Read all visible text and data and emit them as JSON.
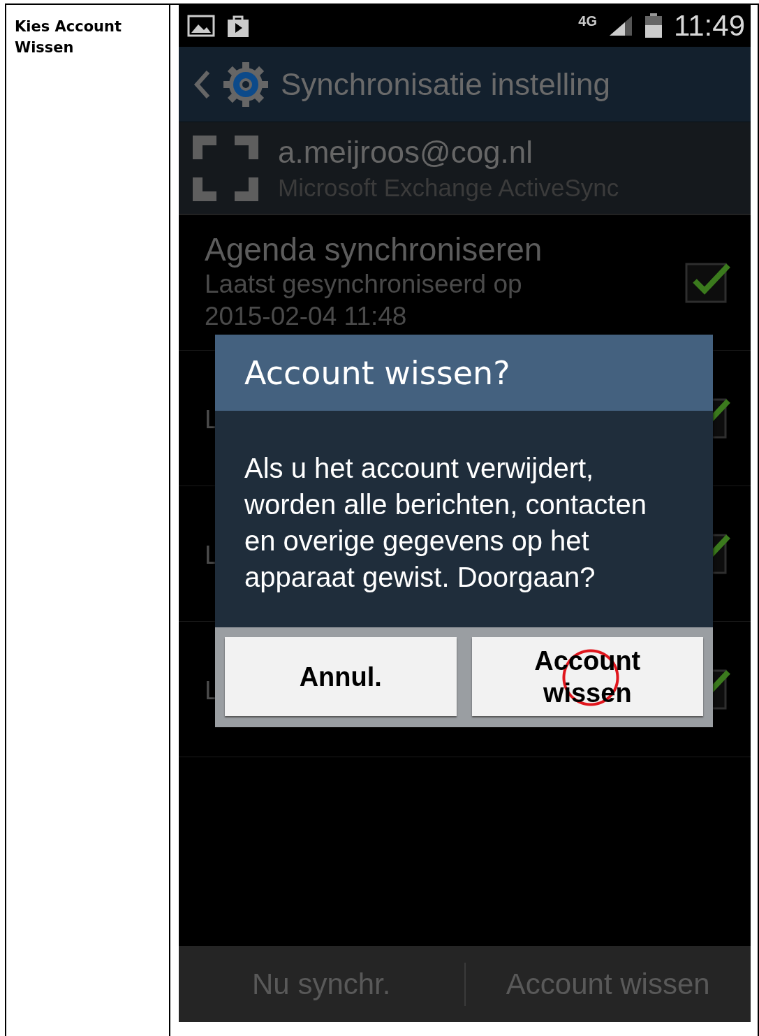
{
  "document": {
    "step_label": "Kies Account Wissen"
  },
  "phone": {
    "status_bar": {
      "network": "4G",
      "time": "11:49"
    },
    "action_bar": {
      "title": "Synchronisatie instelling"
    },
    "account": {
      "email": "a.meijroos@cog.nl",
      "type": "Microsoft Exchange ActiveSync"
    },
    "sync_items": [
      {
        "title": "Agenda synchroniseren",
        "subtitle": "Laatst gesynchroniseerd op",
        "last_sync": "2015-02-04 11:48",
        "checked": true
      },
      {
        "subtitle": "L",
        "checked": true
      },
      {
        "subtitle": "L",
        "checked": true
      },
      {
        "subtitle": "L",
        "checked": true
      }
    ],
    "dialog": {
      "title": "Account wissen?",
      "message": "Als u het account verwijdert, worden alle berichten, contacten en overige gegevens op het apparaat gewist. Doorgaan?",
      "buttons": [
        {
          "label": "Annul.",
          "highlighted": false
        },
        {
          "label": "Account wissen",
          "highlighted": true
        }
      ]
    },
    "bottom_bar": {
      "buttons": [
        "Nu synchr.",
        "Account wissen"
      ]
    }
  }
}
